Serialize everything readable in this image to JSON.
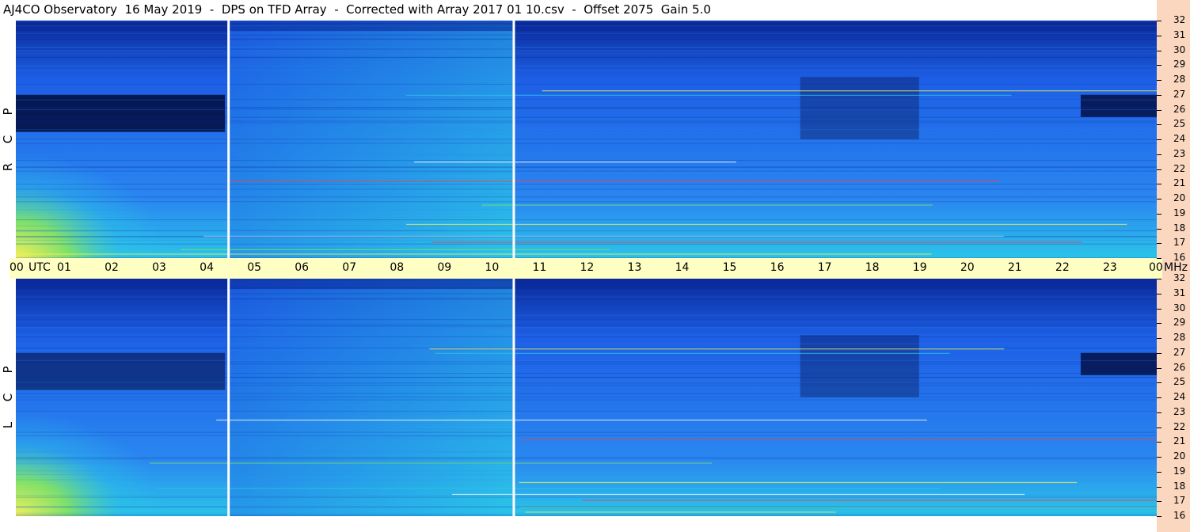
{
  "title": "AJ4CO Observatory  16 May 2019  -  DPS on TFD Array  -  Corrected with Array 2017 01 10.csv  -  Offset 2075  Gain 5.0",
  "chart_data": [
    {
      "type": "heatmap",
      "polarization": [
        "R",
        "C",
        "P"
      ],
      "x_unit": "UTC",
      "y_unit": "MHz",
      "x_ticks": [
        "00",
        "01",
        "02",
        "03",
        "04",
        "05",
        "06",
        "07",
        "08",
        "09",
        "10",
        "11",
        "12",
        "13",
        "14",
        "15",
        "16",
        "17",
        "18",
        "19",
        "20",
        "21",
        "22",
        "23",
        "00"
      ],
      "y_ticks": [
        "16",
        "17",
        "18",
        "19",
        "20",
        "21",
        "22",
        "23",
        "24",
        "25",
        "26",
        "27",
        "28",
        "29",
        "30",
        "31",
        "32"
      ],
      "xlim": [
        0,
        24
      ],
      "ylim": [
        16,
        32
      ]
    },
    {
      "type": "heatmap",
      "polarization": [
        "L",
        "C",
        "P"
      ],
      "x_unit": "UTC",
      "y_unit": "MHz",
      "x_ticks": [
        "00",
        "01",
        "02",
        "03",
        "04",
        "05",
        "06",
        "07",
        "08",
        "09",
        "10",
        "11",
        "12",
        "13",
        "14",
        "15",
        "16",
        "17",
        "18",
        "19",
        "20",
        "21",
        "22",
        "23",
        "00"
      ],
      "y_ticks": [
        "16",
        "17",
        "18",
        "19",
        "20",
        "21",
        "22",
        "23",
        "24",
        "25",
        "26",
        "27",
        "28",
        "29",
        "30",
        "31",
        "32"
      ],
      "xlim": [
        0,
        24
      ],
      "ylim": [
        16,
        32
      ]
    }
  ],
  "time_axis": {
    "labels": [
      "00",
      "UTC",
      "01",
      "02",
      "03",
      "04",
      "05",
      "06",
      "07",
      "08",
      "09",
      "10",
      "11",
      "12",
      "13",
      "14",
      "15",
      "16",
      "17",
      "18",
      "19",
      "20",
      "21",
      "22",
      "23",
      "00",
      "MHz"
    ]
  },
  "colors": {
    "deep": "#020a3a",
    "dark_blue": "#0a2a9a",
    "blue": "#1d5fe6",
    "mid_blue": "#2a86f0",
    "cyan": "#2bc4e8",
    "green": "#7ee06a",
    "yellow": "#f2f05a",
    "red": "#ff3b3b",
    "time_bar": "#ffffc4",
    "right_band": "#fbd7c0"
  }
}
